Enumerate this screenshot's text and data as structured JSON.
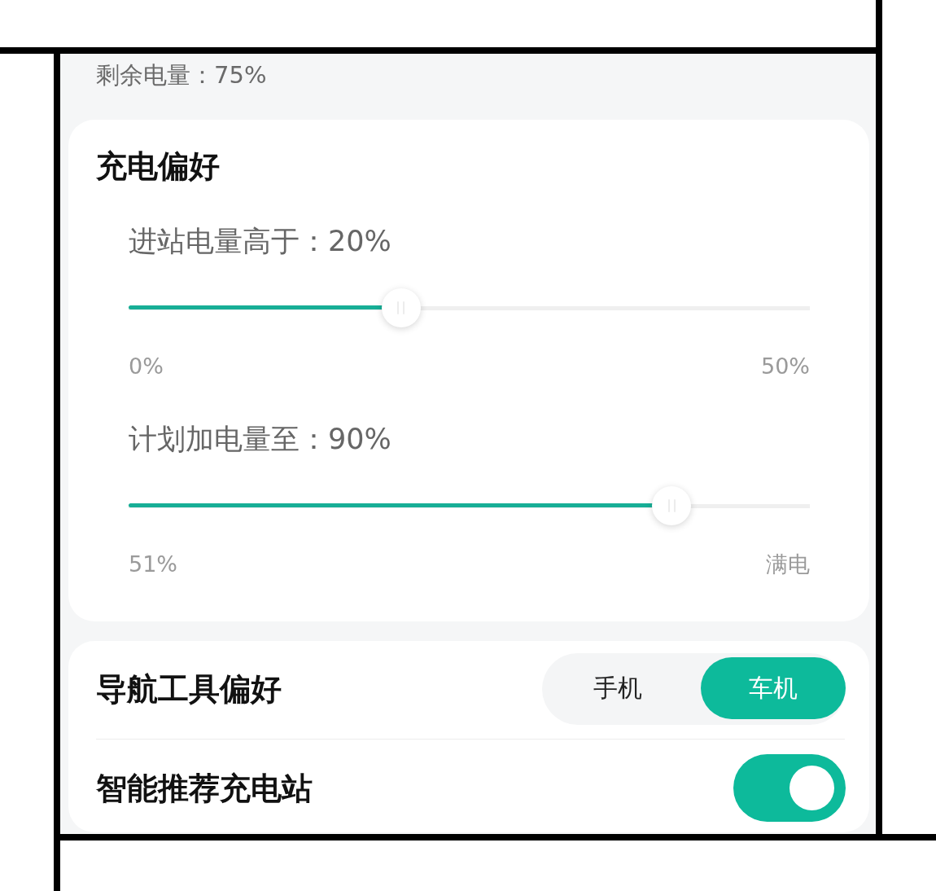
{
  "battery": {
    "label": "剩余电量：75%"
  },
  "charging_preferences": {
    "title": "充电偏好",
    "sliders": [
      {
        "label": "进站电量高于：20%",
        "level": 0.4,
        "min_label": "0%",
        "max_label": "50%"
      },
      {
        "label": "计划加电量至：90%",
        "level": 0.797,
        "min_label": "51%",
        "max_label": "满电"
      }
    ]
  },
  "settings": [
    {
      "kind": "segmented",
      "label": "导航工具偏好",
      "options": [
        {
          "label": "手机",
          "selected": false
        },
        {
          "label": "车机",
          "selected": true
        }
      ]
    },
    {
      "kind": "toggle",
      "label": "智能推荐充电站",
      "on": true
    }
  ]
}
